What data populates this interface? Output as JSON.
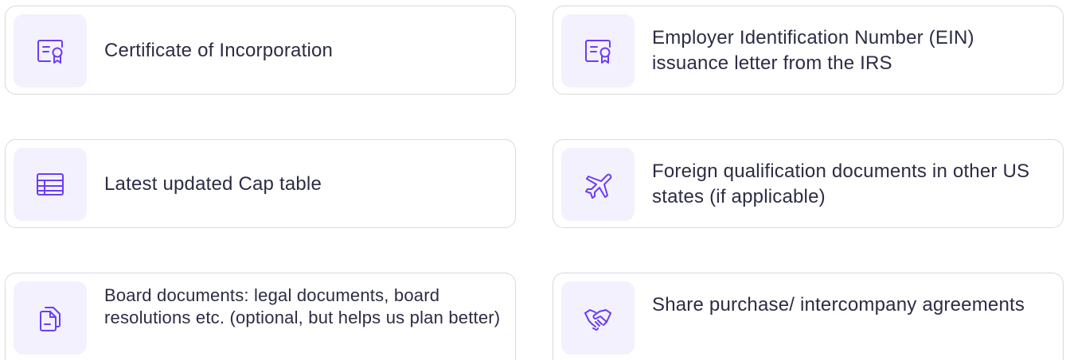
{
  "accent_color": "#6b3df5",
  "icon_background": "#f3f1fe",
  "documents": [
    {
      "icon": "certificate-icon",
      "label": "Certificate of Incorporation"
    },
    {
      "icon": "certificate-icon",
      "label": "Employer Identification Number (EIN) issuance letter from the IRS"
    },
    {
      "icon": "table-icon",
      "label": "Latest updated Cap table"
    },
    {
      "icon": "airplane-icon",
      "label": "Foreign qualification documents in other US states (if applicable)"
    },
    {
      "icon": "documents-icon",
      "label": "Board documents: legal documents, board resolutions etc. (optional, but helps us plan better)"
    },
    {
      "icon": "handshake-icon",
      "label": "Share purchase/ intercompany agreements"
    }
  ]
}
